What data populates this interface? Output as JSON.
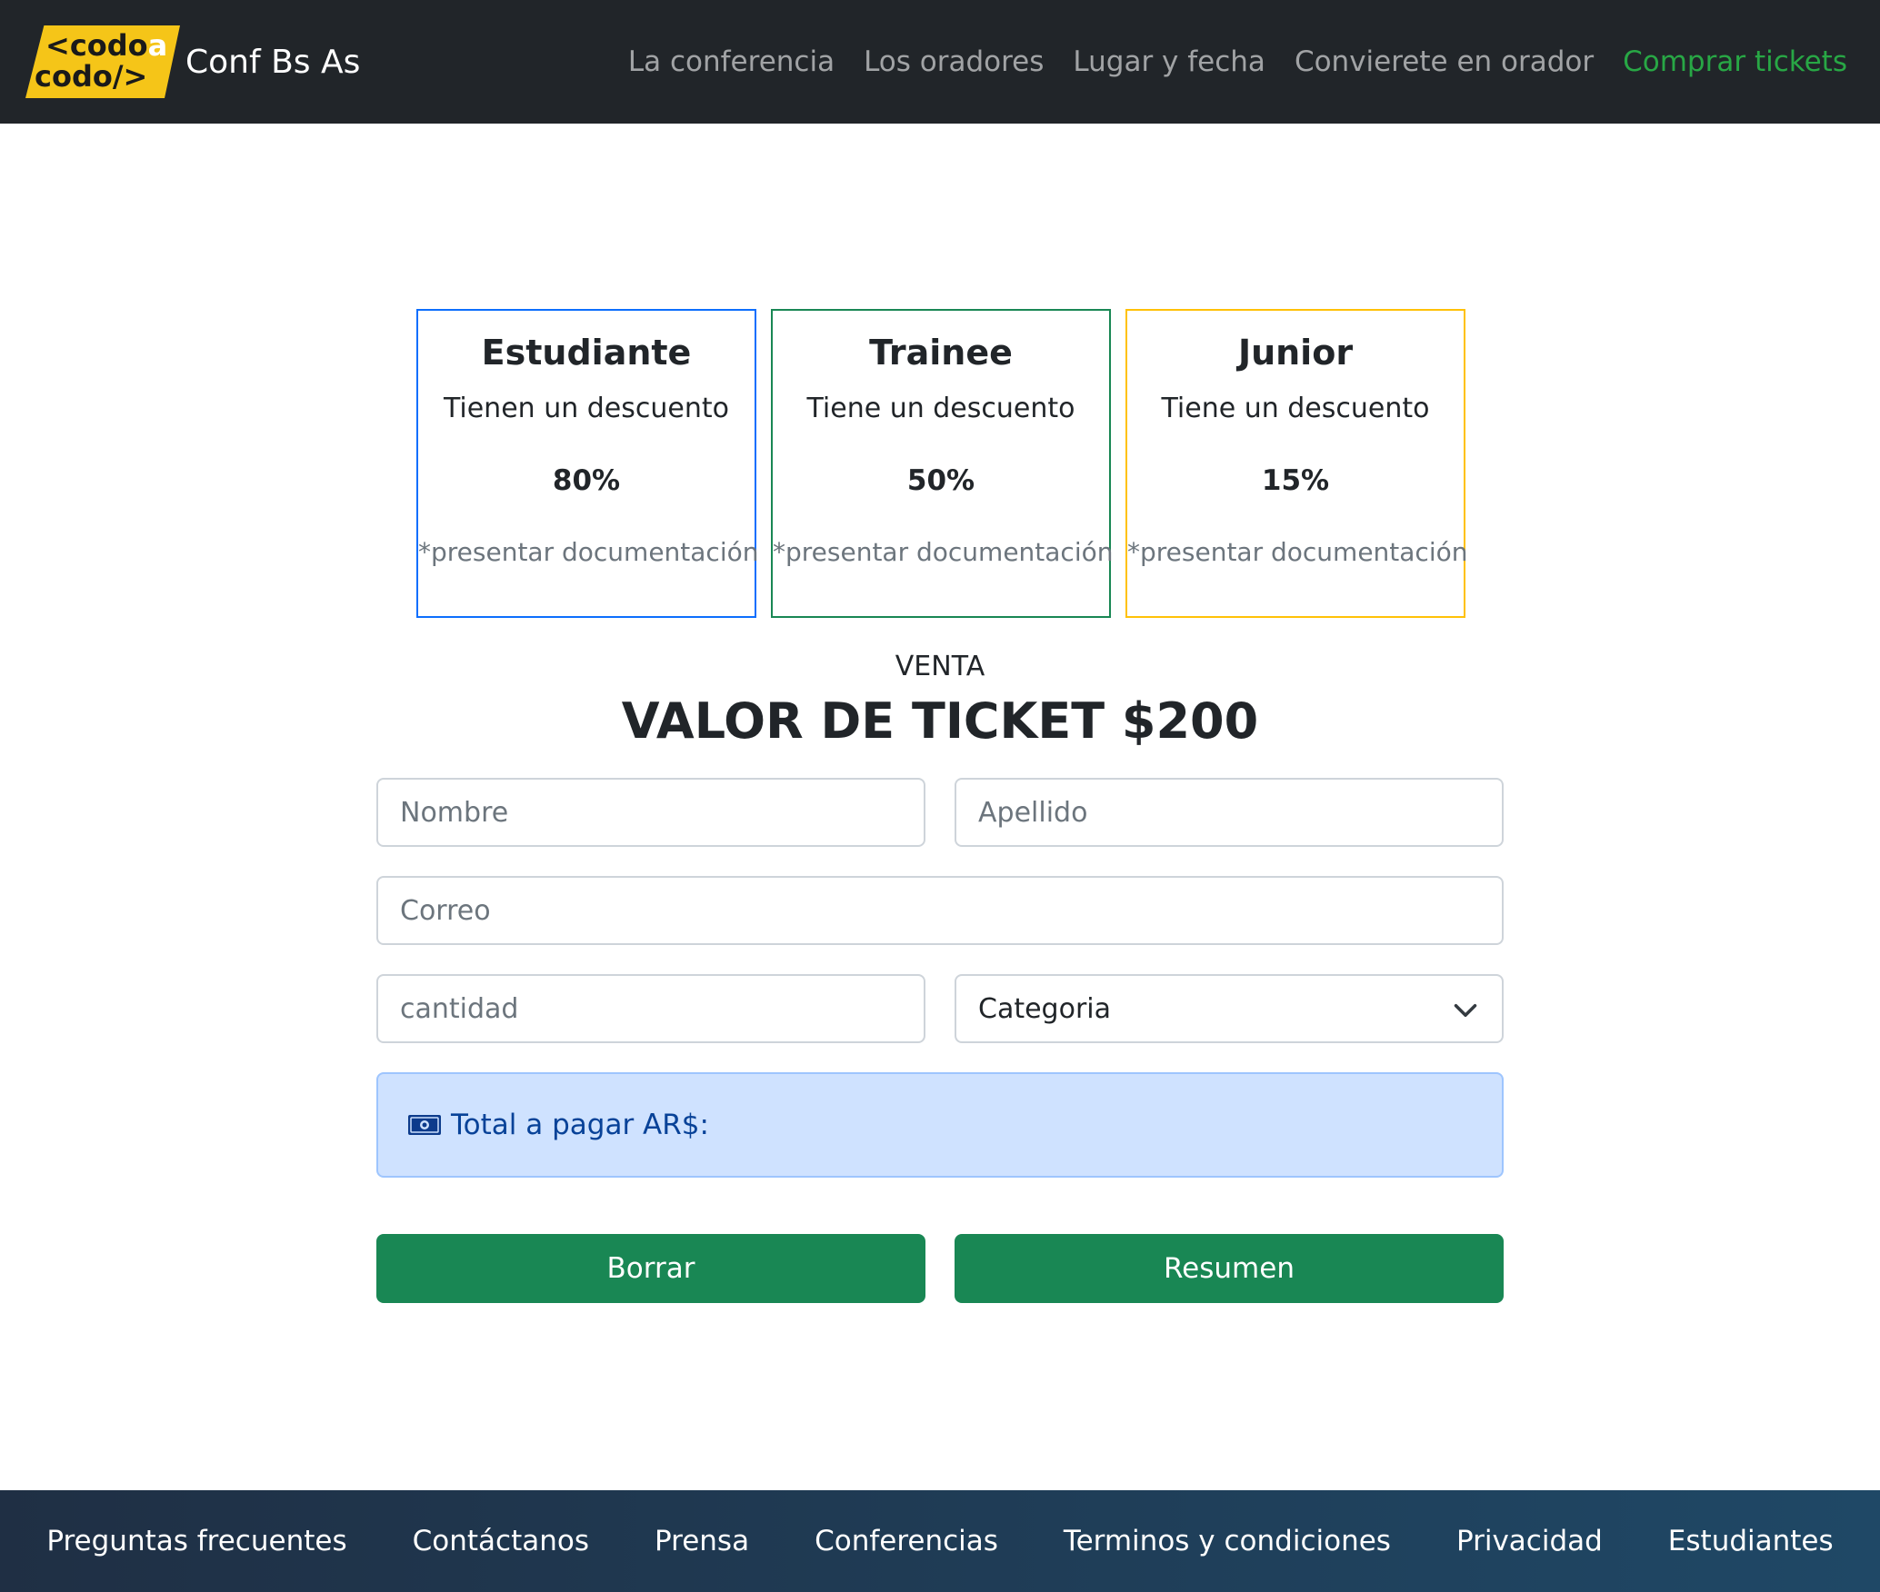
{
  "navbar": {
    "logo": {
      "line1_a": "<codo",
      "line1_b": "a",
      "line2": "codo/>"
    },
    "brand": "Conf Bs As",
    "links": [
      "La conferencia",
      "Los oradores",
      "Lugar y fecha",
      "Convierete en orador",
      "Comprar tickets"
    ],
    "active_link": "Comprar tickets",
    "colors": {
      "background": "#212529",
      "active": "#28a745"
    }
  },
  "cards": [
    {
      "title": "Estudiante",
      "subtitle": "Tienen un descuento",
      "discount": "80%",
      "note": "*presentar documentación",
      "border": "#0d6efd"
    },
    {
      "title": "Trainee",
      "subtitle": "Tiene un descuento",
      "discount": "50%",
      "note": "*presentar documentación",
      "border": "#198754"
    },
    {
      "title": "Junior",
      "subtitle": "Tiene un descuento",
      "discount": "15%",
      "note": "*presentar documentación",
      "border": "#ffc107"
    }
  ],
  "sale": {
    "label": "VENTA",
    "title": "VALOR DE TICKET $200"
  },
  "form": {
    "nombre_placeholder": "Nombre",
    "apellido_placeholder": "Apellido",
    "correo_placeholder": "Correo",
    "cantidad_placeholder": "cantidad",
    "categoria_selected": "Categoria",
    "total_label": "Total a pagar AR$:",
    "total_icon": "money-icon",
    "borrar_label": "Borrar",
    "resumen_label": "Resumen",
    "button_color": "#198754"
  },
  "footer": {
    "links": [
      "Preguntas frecuentes",
      "Contáctanos",
      "Prensa",
      "Conferencias",
      "Terminos y condiciones",
      "Privacidad",
      "Estudiantes"
    ]
  }
}
